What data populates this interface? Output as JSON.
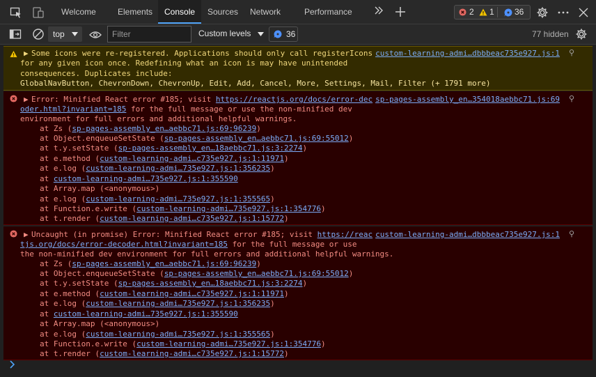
{
  "tabs": [
    {
      "label": "Welcome"
    },
    {
      "label": "Elements"
    },
    {
      "label": "Console"
    },
    {
      "label": "Sources"
    },
    {
      "label": "Network"
    },
    {
      "label": "Performance"
    }
  ],
  "counts": {
    "errors": "2",
    "warnings": "1",
    "issues": "36"
  },
  "toolbar": {
    "context": "top",
    "filter_placeholder": "Filter",
    "levels": "Custom levels",
    "issues_count": "36",
    "hidden": "77 hidden"
  },
  "warning": {
    "lines": [
      "Some icons were re-registered. Applications should only call registerIcons",
      "for any given icon once. Redefining what an icon is may have unintended",
      "consequences. Duplicates include:",
      "GlobalNavButton, ChevronDown, ChevronUp, Edit, Add, Cancel, More, Settings, Mail, Filter (+ 1791 more)"
    ],
    "source": "custom-learning-admi…dbbbeac735e927.js:1"
  },
  "errors": [
    {
      "head": [
        {
          "text": "Error: Minified React error #185; visit ",
          "link": "https://reactjs.org/docs/error-dec"
        },
        {
          "text": "",
          "link": "oder.html?invariant=185",
          "after": " for the full message or use the non-minified dev"
        },
        {
          "text": "environment for full errors and additional helpful warnings."
        }
      ],
      "source": "sp-pages-assembly_en…354018aebbc71.js:69",
      "stack": [
        {
          "fn": "at Zs (",
          "loc": "sp-pages-assembly_en…aebbc71.js:69:96239",
          "end": ")"
        },
        {
          "fn": "at Object.enqueueSetState (",
          "loc": "sp-pages-assembly_en…aebbc71.js:69:55012",
          "end": ")"
        },
        {
          "fn": "at t.y.setState (",
          "loc": "sp-pages-assembly_en…18aebbc71.js:3:2274",
          "end": ")"
        },
        {
          "fn": "at e.method (",
          "loc": "custom-learning-admi…c735e927.js:1:11971",
          "end": ")"
        },
        {
          "fn": "at e.log (",
          "loc": "custom-learning-admi…735e927.js:1:356235",
          "end": ")"
        },
        {
          "fn": "at ",
          "loc": "custom-learning-admi…735e927.js:1:355590",
          "end": ""
        },
        {
          "fn": "at Array.map (<anonymous>)",
          "loc": "",
          "end": ""
        },
        {
          "fn": "at e.log (",
          "loc": "custom-learning-admi…735e927.js:1:355565",
          "end": ")"
        },
        {
          "fn": "at Function.e.write (",
          "loc": "custom-learning-admi…735e927.js:1:354776",
          "end": ")"
        },
        {
          "fn": "at t.render (",
          "loc": "custom-learning-admi…c735e927.js:1:15772",
          "end": ")"
        }
      ]
    },
    {
      "head": [
        {
          "text": "Uncaught (in promise) Error: Minified React error #185; visit ",
          "link": "https://reac"
        },
        {
          "text": "",
          "link": "tjs.org/docs/error-decoder.html?invariant=185",
          "after": " for the full message or use"
        },
        {
          "text": "the non-minified dev environment for full errors and additional helpful warnings."
        }
      ],
      "source": "custom-learning-admi…dbbbeac735e927.js:1",
      "stack": [
        {
          "fn": "at Zs (",
          "loc": "sp-pages-assembly_en…aebbc71.js:69:96239",
          "end": ")"
        },
        {
          "fn": "at Object.enqueueSetState (",
          "loc": "sp-pages-assembly_en…aebbc71.js:69:55012",
          "end": ")"
        },
        {
          "fn": "at t.y.setState (",
          "loc": "sp-pages-assembly_en…18aebbc71.js:3:2274",
          "end": ")"
        },
        {
          "fn": "at e.method (",
          "loc": "custom-learning-admi…c735e927.js:1:11971",
          "end": ")"
        },
        {
          "fn": "at e.log (",
          "loc": "custom-learning-admi…735e927.js:1:356235",
          "end": ")"
        },
        {
          "fn": "at ",
          "loc": "custom-learning-admi…735e927.js:1:355590",
          "end": ""
        },
        {
          "fn": "at Array.map (<anonymous>)",
          "loc": "",
          "end": ""
        },
        {
          "fn": "at e.log (",
          "loc": "custom-learning-admi…735e927.js:1:355565",
          "end": ")"
        },
        {
          "fn": "at Function.e.write (",
          "loc": "custom-learning-admi…735e927.js:1:354776",
          "end": ")"
        },
        {
          "fn": "at t.render (",
          "loc": "custom-learning-admi…c735e927.js:1:15772",
          "end": ")"
        }
      ]
    }
  ],
  "colors": {
    "accent": "#4fa3f7",
    "error_text": "#f28b82",
    "warning_text": "#f0d77c",
    "link": "#7cacf8"
  }
}
